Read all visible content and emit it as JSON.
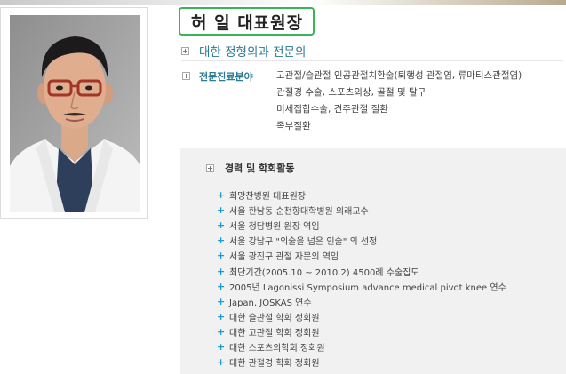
{
  "profile": {
    "name": "허 일 대표원장",
    "hospital": "대한 정형외과 전문의",
    "photo": "doctor-portrait"
  },
  "specialty": {
    "label": "전문진료분야",
    "lines": [
      "고관절/슬관절 인공관절치환술(퇴행성 관절염, 류마티스관절염)",
      "관절경 수술, 스포츠외상, 골절 및 탈구",
      "미세접합수술, 견주관절 질환",
      "족부질환"
    ]
  },
  "career": {
    "title": "경력 및 학회활동",
    "items": [
      "희망찬병원 대표원장",
      "서울 한남동 순천향대학병원 외래교수",
      "서울 청담병원 원장 역임",
      "서울 강남구 \"의술을 넘은 인술\" 의 선정",
      "서울 광진구 관절 자문의 역임",
      "최단기간(2005.10 ~ 2010.2) 4500례 수술집도",
      "2005년 Lagonissi Symposium advance medical pivot knee 연수",
      "Japan, JOSKAS 연수",
      "대한 슬관절 학회 정회원",
      "대한 고관절 학회 정회원",
      "대한 스포츠의학회 정회원",
      "대한 관절경 학회 정회원"
    ]
  },
  "colors": {
    "accent": "#2a7a94",
    "name_border": "#3bb35b",
    "bullet": "#1a9bd1",
    "panel_bg": "#f1f1f1"
  },
  "icons": {
    "expand": "plus-icon",
    "bullet": "plus-bullet-icon"
  }
}
